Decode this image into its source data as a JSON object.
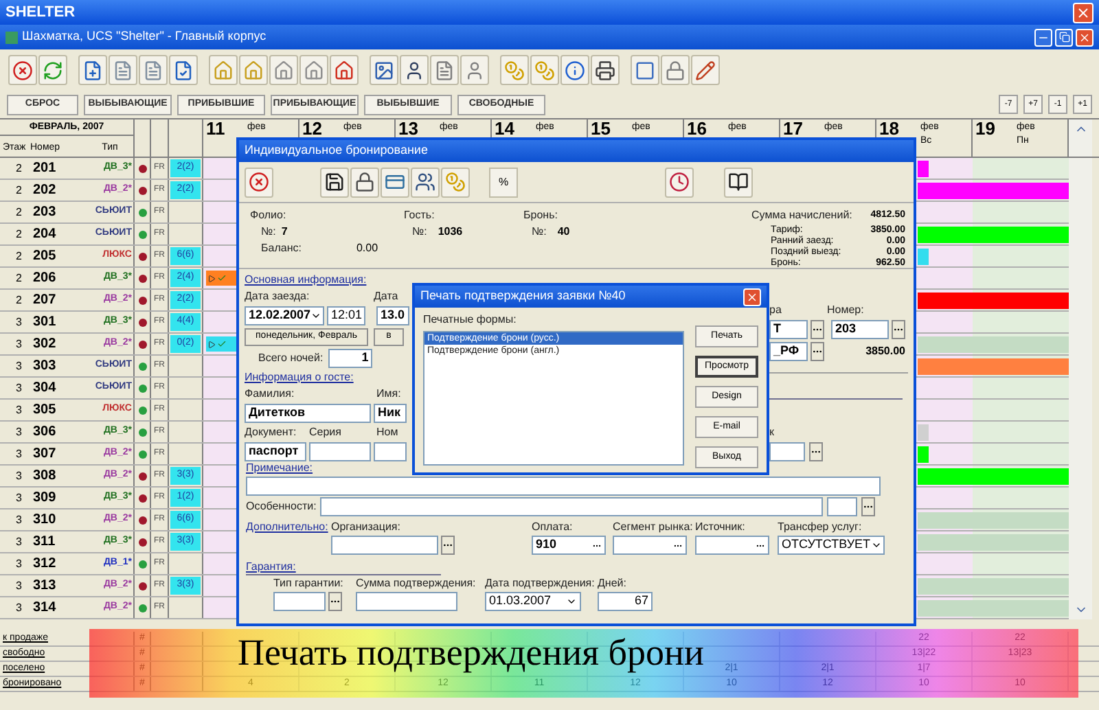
{
  "app_title": "SHELTER",
  "window": {
    "title": "Шахматка, UCS \"Shelter\" - Главный корпус"
  },
  "filters": [
    "СБРОС",
    "ВЫБЫВАЮЩИЕ",
    "ПРИБЫВШИЕ",
    "ПРИБЫВАЮЩИЕ",
    "ВЫБЫВШИЕ",
    "СВОБОДНЫЕ"
  ],
  "nav_buttons": [
    "-7",
    "+7",
    "-1",
    "+1"
  ],
  "grid": {
    "month": "ФЕВРАЛЬ, 2007",
    "columns": [
      "Этаж",
      "Номер",
      "Тип"
    ],
    "days": [
      {
        "day": "11",
        "month": "фев",
        "summary": {
          "booked": "4"
        }
      },
      {
        "day": "12",
        "month": "фев",
        "summary": {
          "booked": "2"
        }
      },
      {
        "day": "13",
        "month": "фев",
        "summary": {
          "booked": "12"
        }
      },
      {
        "day": "14",
        "month": "фев",
        "summary": {
          "booked": "11"
        }
      },
      {
        "day": "15",
        "month": "фев",
        "summary": {
          "booked": "12"
        }
      },
      {
        "day": "16",
        "month": "фев",
        "summary": {
          "settled": "2|1",
          "booked": "10"
        }
      },
      {
        "day": "17",
        "month": "фев",
        "summary": {
          "settled": "2|1",
          "booked": "12"
        }
      },
      {
        "day": "18",
        "month": "фев",
        "weekday": "Вс",
        "summary": {
          "for_sale": "22",
          "free": "13|22",
          "settled": "1|7",
          "booked": "10"
        }
      },
      {
        "day": "19",
        "month": "фев",
        "weekday": "Пн",
        "summary": {
          "for_sale": "22",
          "free": "13|23",
          "booked": "10"
        }
      }
    ],
    "rows": [
      {
        "floor": "2",
        "number": "201",
        "type": {
          "label": "ДВ_3*",
          "color": "#207020"
        },
        "status": {
          "color": "#a0182c"
        },
        "rate": "FR",
        "count": "2(2)",
        "bar": {
          "color": "#ff00ff",
          "kind": "stub"
        }
      },
      {
        "floor": "2",
        "number": "202",
        "type": {
          "label": "ДВ_2*",
          "color": "#9a3aa0"
        },
        "status": {
          "color": "#a0182c"
        },
        "rate": "FR",
        "count": "2(2)",
        "bar": {
          "color": "#ff00ff",
          "kind": "full"
        }
      },
      {
        "floor": "2",
        "number": "203",
        "type": {
          "label": "СЬЮИТ",
          "color": "#303a80"
        },
        "status": {
          "color": "#28a040"
        },
        "rate": "FR"
      },
      {
        "floor": "2",
        "number": "204",
        "type": {
          "label": "СЬЮИТ",
          "color": "#303a80"
        },
        "status": {
          "color": "#28a040"
        },
        "rate": "FR",
        "bar": {
          "color": "#00ff00",
          "kind": "full"
        }
      },
      {
        "floor": "2",
        "number": "205",
        "type": {
          "label": "ЛЮКС",
          "color": "#c03030"
        },
        "status": {
          "color": "#a0182c"
        },
        "rate": "FR",
        "count": "6(6)",
        "bar": {
          "color": "#33ddee",
          "kind": "stub"
        }
      },
      {
        "floor": "2",
        "number": "206",
        "type": {
          "label": "ДВ_3*",
          "color": "#207020"
        },
        "status": {
          "color": "#a0182c"
        },
        "rate": "FR",
        "count": "2(4)",
        "start_flag": {
          "color": "#ff8020"
        }
      },
      {
        "floor": "2",
        "number": "207",
        "type": {
          "label": "ДВ_2*",
          "color": "#9a3aa0"
        },
        "status": {
          "color": "#a0182c"
        },
        "rate": "FR",
        "count": "2(2)",
        "bar": {
          "color": "#ff0000",
          "kind": "full"
        }
      },
      {
        "floor": "3",
        "number": "301",
        "type": {
          "label": "ДВ_3*",
          "color": "#207020"
        },
        "status": {
          "color": "#a0182c"
        },
        "rate": "FR",
        "count": "4(4)"
      },
      {
        "floor": "3",
        "number": "302",
        "type": {
          "label": "ДВ_2*",
          "color": "#9a3aa0"
        },
        "status": {
          "color": "#a0182c"
        },
        "rate": "FR",
        "count": "0(2)",
        "start_flag": {
          "color": "#33ddee"
        },
        "bar": {
          "color": "#c4dcc4",
          "kind": "full"
        }
      },
      {
        "floor": "3",
        "number": "303",
        "type": {
          "label": "СЬЮИТ",
          "color": "#303a80"
        },
        "status": {
          "color": "#28a040"
        },
        "rate": "FR",
        "bar": {
          "color": "#ff8040",
          "kind": "full"
        }
      },
      {
        "floor": "3",
        "number": "304",
        "type": {
          "label": "СЬЮИТ",
          "color": "#303a80"
        },
        "status": {
          "color": "#28a040"
        },
        "rate": "FR"
      },
      {
        "floor": "3",
        "number": "305",
        "type": {
          "label": "ЛЮКС",
          "color": "#c03030"
        },
        "status": {
          "color": "#28a040"
        },
        "rate": "FR"
      },
      {
        "floor": "3",
        "number": "306",
        "type": {
          "label": "ДВ_3*",
          "color": "#207020"
        },
        "status": {
          "color": "#28a040"
        },
        "rate": "FR",
        "bar": {
          "color": "#d0d0d0",
          "kind": "stub"
        }
      },
      {
        "floor": "3",
        "number": "307",
        "type": {
          "label": "ДВ_2*",
          "color": "#9a3aa0"
        },
        "status": {
          "color": "#28a040"
        },
        "rate": "FR",
        "bar": {
          "color": "#00ff00",
          "kind": "stub"
        }
      },
      {
        "floor": "3",
        "number": "308",
        "type": {
          "label": "ДВ_2*",
          "color": "#9a3aa0"
        },
        "status": {
          "color": "#a0182c"
        },
        "rate": "FR",
        "count": "3(3)",
        "bar": {
          "color": "#00ff00",
          "kind": "full"
        }
      },
      {
        "floor": "3",
        "number": "309",
        "type": {
          "label": "ДВ_3*",
          "color": "#207020"
        },
        "status": {
          "color": "#a0182c"
        },
        "rate": "FR",
        "count": "1(2)"
      },
      {
        "floor": "3",
        "number": "310",
        "type": {
          "label": "ДВ_2*",
          "color": "#9a3aa0"
        },
        "status": {
          "color": "#a0182c"
        },
        "rate": "FR",
        "count": "6(6)",
        "bar": {
          "color": "#c4dcc4",
          "kind": "full"
        }
      },
      {
        "floor": "3",
        "number": "311",
        "type": {
          "label": "ДВ_3*",
          "color": "#207020"
        },
        "status": {
          "color": "#a0182c"
        },
        "rate": "FR",
        "count": "3(3)",
        "bar": {
          "color": "#c4dcc4",
          "kind": "full"
        }
      },
      {
        "floor": "3",
        "number": "312",
        "type": {
          "label": "ДВ_1*",
          "color": "#2030c0"
        },
        "status": {
          "color": "#28a040"
        },
        "rate": "FR"
      },
      {
        "floor": "3",
        "number": "313",
        "type": {
          "label": "ДВ_2*",
          "color": "#9a3aa0"
        },
        "status": {
          "color": "#a0182c"
        },
        "rate": "FR",
        "count": "3(3)",
        "bar": {
          "color": "#c4dcc4",
          "kind": "full"
        }
      },
      {
        "floor": "3",
        "number": "314",
        "type": {
          "label": "ДВ_2*",
          "color": "#9a3aa0"
        },
        "status": {
          "color": "#28a040"
        },
        "rate": "FR",
        "bar": {
          "color": "#c4dcc4",
          "kind": "full"
        }
      }
    ],
    "summary_labels": [
      {
        "label": "к продаже",
        "mark": "#"
      },
      {
        "label": "свободно",
        "mark": "#"
      },
      {
        "label": "поселено",
        "mark": "#"
      },
      {
        "label": "бронировано",
        "mark": "#"
      }
    ]
  },
  "booking_dialog": {
    "title": "Индивидуальное бронирование",
    "percent_button": "%",
    "folio": {
      "label": "Фолио:",
      "number_label": "№:",
      "number": "7",
      "balance_label": "Баланс:",
      "balance": "0.00"
    },
    "guest": {
      "label": "Гость:",
      "number_label": "№:",
      "number": "1036"
    },
    "booking": {
      "label": "Бронь:",
      "number_label": "№:",
      "number": "40"
    },
    "charges": {
      "label": "Сумма начислений:",
      "value": "4812.50",
      "items": [
        {
          "label": "Тариф:",
          "value": "3850.00"
        },
        {
          "label": "Ранний заезд:",
          "value": "0.00"
        },
        {
          "label": "Поздний выезд:",
          "value": "0.00"
        },
        {
          "label": "Бронь:",
          "value": "962.50"
        }
      ]
    },
    "main_section": "Основная информация:",
    "checkin": {
      "label": "Дата заезда:",
      "date": "12.02.2007",
      "time": "12:01",
      "weekday": "понедельник, Февраль"
    },
    "checkout": {
      "label": "Дата",
      "date": "13.0",
      "weekday": "в"
    },
    "nights": {
      "label": "Всего ночей:",
      "value": "1"
    },
    "category": {
      "label": "ра",
      "value": "Т"
    },
    "room": {
      "label": "Номер:",
      "value": "203"
    },
    "rate": {
      "value": "_РФ",
      "price": "3850.00"
    },
    "guest_section": "Информация о госте:",
    "last_name": {
      "label": "Фамилия:",
      "value": "Дитетков"
    },
    "first_name": {
      "label": "Имя:",
      "value": "Ник"
    },
    "document": {
      "label": "Документ:",
      "value": "паспорт"
    },
    "series": {
      "label": "Серия"
    },
    "doc_number": {
      "label": "Ном"
    },
    "cut_field": {
      "label": "к"
    },
    "note_section": "Примечание:",
    "features": {
      "label": "Особенности:"
    },
    "extra_section": "Дополнительно:",
    "organization": {
      "label": "Организация:"
    },
    "payment": {
      "label": "Оплата:",
      "value": "910"
    },
    "segment": {
      "label": "Сегмент рынка:"
    },
    "source": {
      "label": "Источник:"
    },
    "transfer": {
      "label": "Трансфер услуг:",
      "value": "ОТСУТСТВУЕТ"
    },
    "guarantee_section": "Гарантия:",
    "guarantee_type": {
      "label": "Тип гарантии:"
    },
    "confirm_sum": {
      "label": "Сумма подтверждения:"
    },
    "confirm_date": {
      "label": "Дата подтверждения:",
      "value": "01.03.2007"
    },
    "days": {
      "label": "Дней:",
      "value": "67"
    }
  },
  "print_dialog": {
    "title": "Печать подтверждения заявки №40",
    "forms_label": "Печатные формы:",
    "forms": [
      {
        "label": "Подтверждение брони (русс.)",
        "selected": true
      },
      {
        "label": "Подтверждение брони (англ.)",
        "selected": false
      }
    ],
    "buttons": [
      {
        "label": "Печать",
        "focused": false
      },
      {
        "label": "Просмотр",
        "focused": true
      },
      {
        "label": "Design",
        "focused": false
      },
      {
        "label": "E-mail",
        "focused": false
      },
      {
        "label": "Выход",
        "focused": false
      }
    ]
  },
  "caption": "Печать подтверждения брони"
}
